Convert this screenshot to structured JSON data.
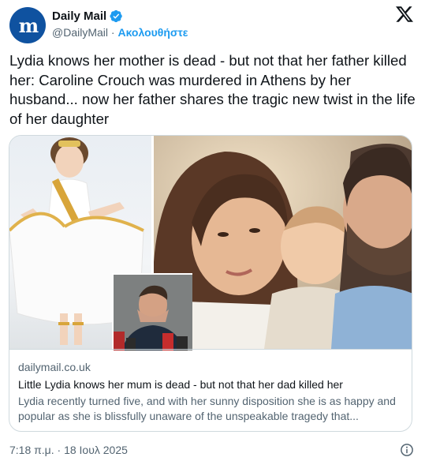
{
  "account": {
    "avatar_text": "m",
    "name": "Daily Mail",
    "handle": "@DailyMail",
    "separator": "·",
    "follow_label": "Ακολουθήστε"
  },
  "tweet": {
    "text": "Lydia knows her mother is dead - but not that her father killed her: Caroline Crouch was murdered in Athens by her husband... now her father shares the tragic new twist in the life of her daughter"
  },
  "card": {
    "domain": "dailymail.co.uk",
    "title": "Little Lydia knows her mum is dead - but not that her dad killed her",
    "description": "Lydia recently turned five, and with her sunny disposition she is as happy and popular as she is blissfully unaware of the unspeakable tragedy that..."
  },
  "footer": {
    "timestamp": "7:18 π.μ. · 18 Ιουλ 2025"
  },
  "colors": {
    "accent": "#1d9bf0",
    "brand": "#0f52a0",
    "text": "#0f1419",
    "secondary": "#536471",
    "border": "#cfd9de"
  },
  "icons": {
    "verified": "verified-badge-icon",
    "logo": "x-logo-icon",
    "info": "info-icon"
  }
}
